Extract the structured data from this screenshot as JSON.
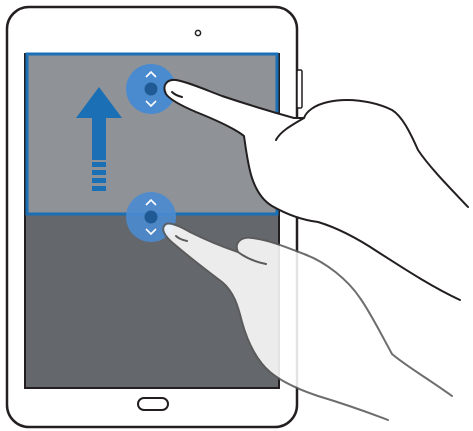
{
  "device": {
    "type": "tablet",
    "orientation": "portrait",
    "body_color": "#ffffff",
    "outline_color": "#231f20"
  },
  "split_view": {
    "top_window": {
      "state": "selected",
      "fill_color": "#8f9296",
      "border_color": "#1a6fb5"
    },
    "bottom_window": {
      "fill_color": "#64676b"
    }
  },
  "gesture": {
    "action": "drag-up",
    "arrow_icon": "arrow-up-icon",
    "arrow_color": "#1a6fb5"
  },
  "handles": [
    {
      "icon": "drag-handle-icon",
      "color": "#4a8bd0"
    },
    {
      "icon": "drag-handle-icon",
      "color": "#4a8bd0"
    }
  ],
  "hands": [
    {
      "icon": "pointing-hand-icon"
    },
    {
      "icon": "pointing-hand-icon"
    }
  ]
}
